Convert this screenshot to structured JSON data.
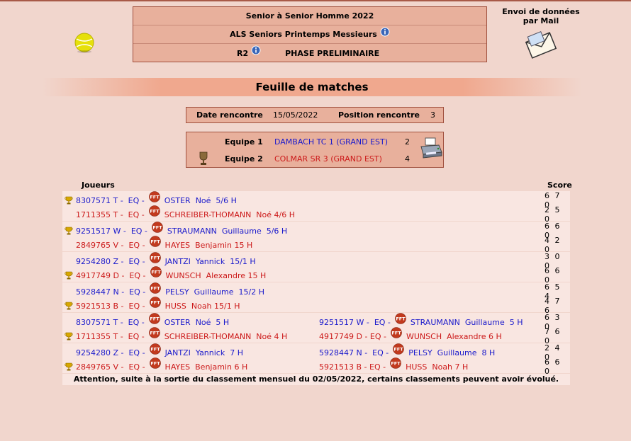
{
  "header": {
    "line1": "Senior  à Senior  Homme  2022",
    "line2": "ALS Seniors Printemps Messieurs",
    "level": "R2",
    "phase": "PHASE PRELIMINAIRE"
  },
  "mail": {
    "line1": "Envoi de données",
    "line2": "par Mail"
  },
  "title": "Feuille de matches",
  "meeting": {
    "date_label": "Date rencontre",
    "date": "15/05/2022",
    "position_label": "Position rencontre",
    "position": "3"
  },
  "teams": [
    {
      "label": "Equipe 1",
      "name": "DAMBACH TC 1 (GRAND EST)",
      "score": "2"
    },
    {
      "label": "Equipe 2",
      "name": "COLMAR SR 3 (GRAND EST)",
      "score": "4"
    }
  ],
  "columns": {
    "players": "Joueurs",
    "score": "Score"
  },
  "matches": [
    {
      "lines": [
        {
          "winner": true,
          "team": "blue",
          "p1": {
            "id": "8307571 T -  EQ -",
            "name": "OSTER  Noé  5/6 H"
          },
          "p2": null,
          "score": "6 7 0"
        },
        {
          "winner": false,
          "team": "red",
          "p1": {
            "id": "1711355 T -  EQ -",
            "name": "SCHREIBER-THOMANN  Noé 4/6 H"
          },
          "p2": null,
          "score": "2 5 0"
        }
      ]
    },
    {
      "lines": [
        {
          "winner": true,
          "team": "blue",
          "p1": {
            "id": "9251517 W -  EQ -",
            "name": "STRAUMANN  Guillaume  5/6 H"
          },
          "p2": null,
          "score": "6 6 0"
        },
        {
          "winner": false,
          "team": "red",
          "p1": {
            "id": "2849765 V -  EQ -",
            "name": "HAYES  Benjamin 15 H"
          },
          "p2": null,
          "score": "4 2 0"
        }
      ]
    },
    {
      "lines": [
        {
          "winner": false,
          "team": "blue",
          "p1": {
            "id": "9254280 Z -  EQ -",
            "name": "JANTZI  Yannick  15/1 H"
          },
          "p2": null,
          "score": "3 0 0"
        },
        {
          "winner": true,
          "team": "red",
          "p1": {
            "id": "4917749 D -  EQ -",
            "name": "WUNSCH  Alexandre 15 H"
          },
          "p2": null,
          "score": "6 6 0"
        }
      ]
    },
    {
      "lines": [
        {
          "winner": false,
          "team": "blue",
          "p1": {
            "id": "5928447 N -  EQ -",
            "name": "PELSY  Guillaume  15/2 H"
          },
          "p2": null,
          "score": "6 5 4"
        },
        {
          "winner": true,
          "team": "red",
          "p1": {
            "id": "5921513 B -  EQ -",
            "name": "HUSS  Noah 15/1 H"
          },
          "p2": null,
          "score": "4 7 6"
        }
      ]
    },
    {
      "lines": [
        {
          "winner": false,
          "team": "blue",
          "p1": {
            "id": "8307571 T -  EQ -",
            "name": "OSTER  Noé  5 H"
          },
          "p2": {
            "id": "9251517 W -  EQ -",
            "name": "STRAUMANN  Guillaume  5 H"
          },
          "score": "6 3 0"
        },
        {
          "winner": true,
          "team": "red",
          "p1": {
            "id": "1711355 T -  EQ -",
            "name": "SCHREIBER-THOMANN  Noé 4 H"
          },
          "p2": {
            "id": "4917749 D - EQ -",
            "name": "WUNSCH  Alexandre 6 H"
          },
          "score": "7 6 0"
        }
      ]
    },
    {
      "lines": [
        {
          "winner": false,
          "team": "blue",
          "p1": {
            "id": "9254280 Z -  EQ -",
            "name": "JANTZI  Yannick  7 H"
          },
          "p2": {
            "id": "5928447 N -  EQ -",
            "name": "PELSY  Guillaume  8 H"
          },
          "score": "2 4 0"
        },
        {
          "winner": true,
          "team": "red",
          "p1": {
            "id": "2849765 V -  EQ -",
            "name": "HAYES  Benjamin 6 H"
          },
          "p2": {
            "id": "5921513 B - EQ -",
            "name": "HUSS  Noah 7 H"
          },
          "score": "6 6 0"
        }
      ]
    }
  ],
  "note": "Attention, suite à la sortie du classement mensuel du 02/05/2022, certains classements peuvent avoir évolué.",
  "icons": {
    "ball": "tennis-ball-icon",
    "info": "info-icon",
    "mail": "envelope-icon",
    "printer": "printer-icon",
    "trophy": "trophy-icon",
    "fft": "fft-logo-icon"
  },
  "colors": {
    "background": "#f1d6cd",
    "box": "#e8b09c",
    "row": "#f9e6e1",
    "team1": "#1a1acc",
    "team2": "#cc1a1a"
  }
}
